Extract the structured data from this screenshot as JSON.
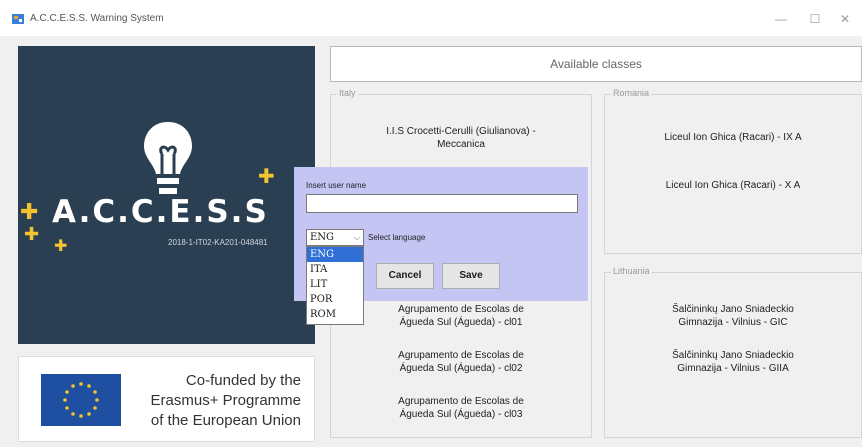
{
  "window": {
    "title": "A.C.C.E.S.S. Warning System",
    "minimize_glyph": "—",
    "maximize_glyph": "☐",
    "close_glyph": "✕",
    "icon": "app-icon"
  },
  "logo": {
    "brand": "A.C.C.E.S.S",
    "project_code": "2018-1-IT02-KA201-048481",
    "plus_glyph": "✚",
    "bulb_icon": "lightbulb-icon"
  },
  "eu": {
    "line1": "Co-funded by the",
    "line2": "Erasmus+ Programme",
    "line3": "of the European Union",
    "flag_icon": "eu-flag-icon"
  },
  "available_classes_label": "Available classes",
  "groups": {
    "italy": {
      "title": "Italy",
      "classes": [
        {
          "line1": "I.I.S Crocetti-Cerulli (Giulianova) -",
          "line2": "Meccanica"
        }
      ]
    },
    "portugal_classes": [
      {
        "line1": "Agrupamento de Escolas de",
        "line2": "Águeda Sul (Águeda) - cl01"
      },
      {
        "line1": "Agrupamento de Escolas de",
        "line2": "Águeda Sul (Águeda) - cl02"
      },
      {
        "line1": "Agrupamento de Escolas de",
        "line2": "Águeda Sul (Águeda) - cl03"
      }
    ],
    "romania": {
      "title": "Romania",
      "classes": [
        "Liceul Ion Ghica (Racari) - IX A",
        "Liceul Ion Ghica (Racari) - X A"
      ]
    },
    "lithuania": {
      "title": "Lithuania",
      "classes": [
        {
          "line1": "Šalčininkų Jano Sniadeckio",
          "line2": "Gimnazija - Vilnius - GIC"
        },
        {
          "line1": "Šalčininkų Jano Sniadeckio",
          "line2": "Gimnazija - Vilnius - GIIA"
        }
      ]
    }
  },
  "dialog": {
    "user_label": "Insert user name",
    "user_value": "",
    "language_selected": "ENG",
    "language_label": "Select language",
    "language_options": [
      "ENG",
      "ITA",
      "LIT",
      "POR",
      "ROM"
    ],
    "cancel_label": "Cancel",
    "save_label": "Save"
  },
  "colors": {
    "logo_bg": "#2b3f52",
    "accent_yellow": "#f4c430",
    "dialog_bg": "#c5c5f4",
    "selection_blue": "#2f6fd6",
    "eu_blue": "#1f4fa0"
  }
}
